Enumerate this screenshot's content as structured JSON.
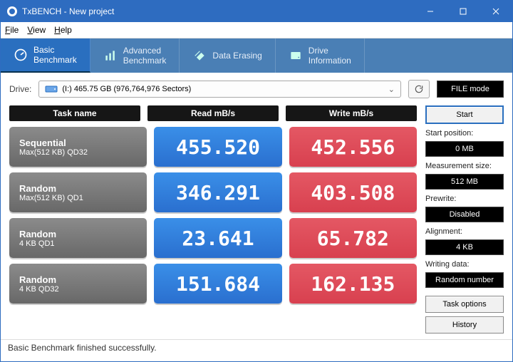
{
  "window": {
    "title": "TxBENCH - New project"
  },
  "menu": {
    "file": "File",
    "view": "View",
    "help": "Help"
  },
  "tabs": {
    "basic": "Basic\nBenchmark",
    "advanced": "Advanced\nBenchmark",
    "erasing": "Data Erasing",
    "info": "Drive\nInformation"
  },
  "drive_label": "Drive:",
  "drive_text": "(I:)   465.75 GB (976,764,976 Sectors)",
  "filemode": "FILE mode",
  "headers": {
    "task": "Task name",
    "read": "Read mB/s",
    "write": "Write mB/s"
  },
  "rows": [
    {
      "t1": "Sequential",
      "t2": "Max(512 KB) QD32",
      "read": "455.520",
      "write": "452.556"
    },
    {
      "t1": "Random",
      "t2": "Max(512 KB) QD1",
      "read": "346.291",
      "write": "403.508"
    },
    {
      "t1": "Random",
      "t2": "4 KB QD1",
      "read": "23.641",
      "write": "65.782"
    },
    {
      "t1": "Random",
      "t2": "4 KB QD32",
      "read": "151.684",
      "write": "162.135"
    }
  ],
  "side": {
    "start": "Start",
    "start_pos_label": "Start position:",
    "start_pos": "0 MB",
    "meas_label": "Measurement size:",
    "meas": "512 MB",
    "prewrite_label": "Prewrite:",
    "prewrite": "Disabled",
    "align_label": "Alignment:",
    "align": "4 KB",
    "writedata_label": "Writing data:",
    "writedata": "Random number",
    "task_options": "Task options",
    "history": "History"
  },
  "status": "Basic Benchmark finished successfully."
}
